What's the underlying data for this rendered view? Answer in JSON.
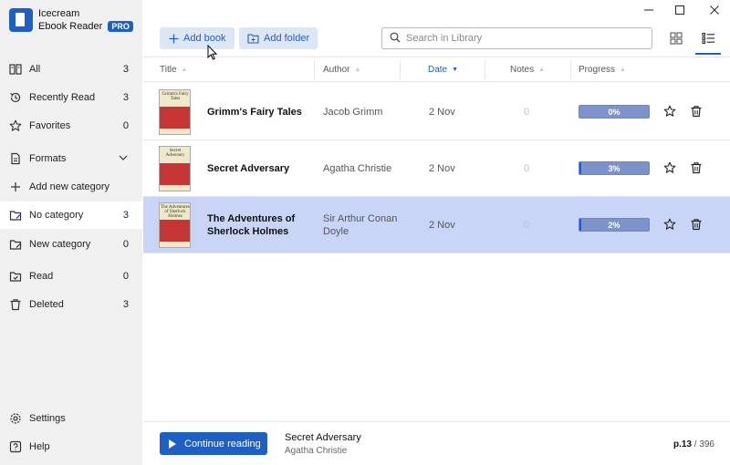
{
  "app": {
    "name_line1": "Icecream",
    "name_line2": "Ebook Reader",
    "badge": "PRO"
  },
  "window_controls": {
    "minimize": "minimize",
    "maximize": "maximize",
    "close": "close"
  },
  "sidebar": {
    "items": [
      {
        "label": "All",
        "count": "3",
        "icon": "library-icon"
      },
      {
        "label": "Recently Read",
        "count": "3",
        "icon": "history-icon"
      },
      {
        "label": "Favorites",
        "count": "0",
        "icon": "star-icon"
      },
      {
        "label": "Formats",
        "count": "",
        "icon": "document-icon"
      },
      {
        "label": "Add new category",
        "count": "",
        "icon": "plus-icon"
      },
      {
        "label": "No category",
        "count": "3",
        "icon": "folder-icon"
      },
      {
        "label": "New category",
        "count": "0",
        "icon": "folder-icon"
      },
      {
        "label": "Read",
        "count": "0",
        "icon": "check-folder-icon"
      },
      {
        "label": "Deleted",
        "count": "3",
        "icon": "trash-icon"
      }
    ],
    "settings_label": "Settings",
    "help_label": "Help"
  },
  "toolbar": {
    "add_book_label": "Add book",
    "add_folder_label": "Add folder",
    "search_placeholder": "Search in Library"
  },
  "table": {
    "columns": {
      "title": "Title",
      "author": "Author",
      "date": "Date",
      "notes": "Notes",
      "progress": "Progress"
    },
    "rows": [
      {
        "cover_text": "Grimm's Fairy Tales",
        "title": "Grimm's Fairy Tales",
        "author": "Jacob Grimm",
        "date": "2 Nov",
        "notes": "0",
        "progress_label": "0%",
        "progress_value": 0,
        "selected": false
      },
      {
        "cover_text": "Secret Adversary",
        "title": "Secret Adversary",
        "author": "Agatha Christie",
        "date": "2 Nov",
        "notes": "0",
        "progress_label": "3%",
        "progress_value": 3,
        "selected": false
      },
      {
        "cover_text": "The Adventures of Sherlock Holmes",
        "title": "The Adventures of Sherlock Holmes",
        "author": "Sir Arthur Conan Doyle",
        "date": "2 Nov",
        "notes": "0",
        "progress_label": "2%",
        "progress_value": 2,
        "selected": true
      }
    ]
  },
  "footer": {
    "continue_label": "Continue reading",
    "current_title": "Secret Adversary",
    "current_author": "Agatha Christie",
    "page_prefix": "p.",
    "page_current": "13",
    "page_separator": " / ",
    "page_total": "396"
  },
  "colors": {
    "accent": "#1e5fc4",
    "sidebar_bg": "#f0f0f0",
    "selected_row": "#c8d5f7"
  }
}
